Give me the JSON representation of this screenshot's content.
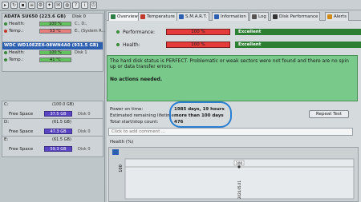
{
  "left": {
    "disk1": {
      "title": "ADATA SU650 (223.6 GB)",
      "disk_label": "Disk 0",
      "health_label": "Health:",
      "health_value": "100 %",
      "health_extra": "C:, D:,",
      "temp_label": "Temp.:",
      "temp_value": "53 °C",
      "temp_extra": "E:, (System R..."
    },
    "disk2": {
      "title": "WDC WD10EZEX-08WN4A0 (931.5 GB)",
      "health_label": "Health:",
      "health_value": "100 %",
      "health_extra": "Disk 1",
      "temp_label": "Temp.:",
      "temp_value": "41 °C"
    },
    "volumes": [
      {
        "title": "C:",
        "size": "(100.0 GB)",
        "fs_label": "Free Space",
        "fs_value": "37.5 GB",
        "disk": "Disk 0"
      },
      {
        "title": "D:",
        "size": "(61.5 GB)",
        "fs_label": "Free Space",
        "fs_value": "47.3 GB",
        "disk": "Disk 0"
      },
      {
        "title": "E:",
        "size": "(61.5 GB)",
        "fs_label": "Free Space",
        "fs_value": "59.3 GB",
        "disk": "Disk 0"
      }
    ]
  },
  "tabs": [
    {
      "label": "Overview",
      "active": true,
      "color": "#2d7d46"
    },
    {
      "label": "Temperature",
      "active": false,
      "color": "#c0392b"
    },
    {
      "label": "S.M.A.R.T.",
      "active": false,
      "color": "#2d5fb0"
    },
    {
      "label": "Information",
      "active": false,
      "color": "#2d5fb0"
    },
    {
      "label": "Log",
      "active": false,
      "color": "#555555"
    },
    {
      "label": "Disk Performance",
      "active": false,
      "color": "#333333"
    },
    {
      "label": "Alerts",
      "active": false,
      "color": "#d28b16"
    }
  ],
  "metrics": {
    "performance": {
      "label": "Performance:",
      "bar": "100 %",
      "status": "Excellent"
    },
    "health": {
      "label": "Health:",
      "bar": "100 %",
      "status": "Excellent"
    }
  },
  "status": {
    "message": "The hard disk status is PERFECT. Problematic or weak sectors were not found and there are no spin up or data transfer errors.",
    "actions": "No actions needed."
  },
  "info": {
    "power_on_label": "Power on time:",
    "power_on_value": "1985 days, 19 hours",
    "remaining_label": "Estimated remaining lifetime:",
    "remaining_value": "more than 100 days",
    "startstop_label": "Total start/stop count:",
    "startstop_value": "476"
  },
  "repeat_button": "Repeat Test",
  "comment_placeholder": "Click to add comment ...",
  "health_chart": {
    "label": "Health (%)",
    "y_tick": "100",
    "point_label": "100",
    "date_label": "2024.05.01"
  },
  "colors": {
    "excellent_green": "#2c7f32",
    "bar_red": "#e53b3b",
    "status_green": "#78c98a",
    "free_space_purple": "#5a45c2",
    "highlight_circle": "#2a7fd0"
  }
}
